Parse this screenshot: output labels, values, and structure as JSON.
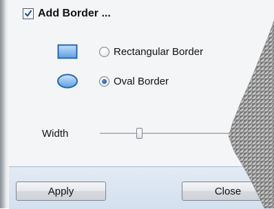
{
  "header": {
    "checked": true,
    "label": "Add Border ..."
  },
  "border_options": [
    {
      "icon": "rectangle-border-icon",
      "label": "Rectangular Border",
      "selected": false
    },
    {
      "icon": "oval-border-icon",
      "label": "Oval Border",
      "selected": true
    }
  ],
  "width": {
    "label": "Width",
    "value_fraction": 0.3
  },
  "footer": {
    "apply_label": "Apply",
    "close_label": "Close"
  },
  "colors": {
    "footer_bg": "#d9e4f0",
    "icon_fill": "#7fb2e5",
    "icon_stroke": "#2a65b5"
  }
}
